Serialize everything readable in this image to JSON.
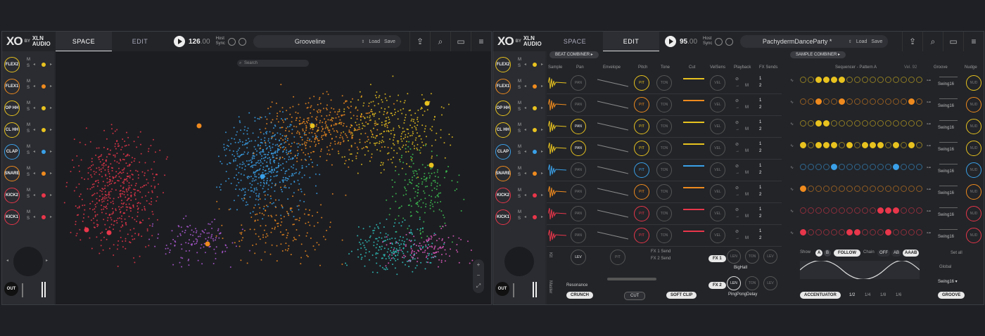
{
  "left": {
    "logo": {
      "mark": "XO",
      "by": "BY",
      "brand1": "XLN",
      "brand2": "AUDIO"
    },
    "tabs": [
      {
        "label": "SPACE",
        "active": true
      },
      {
        "label": "EDIT",
        "active": false
      }
    ],
    "bpm_int": "126",
    "bpm_dec": ".00",
    "host1": "Host",
    "host2": "Sync",
    "preset": "Grooveline",
    "load": "Load",
    "save": "Save",
    "search_placeholder": "Search",
    "out": "OUT",
    "zoom": [
      "+",
      "−",
      "⤢"
    ]
  },
  "right": {
    "logo": {
      "mark": "XO",
      "by": "BY",
      "brand1": "XLN",
      "brand2": "AUDIO"
    },
    "tabs": [
      {
        "label": "SPACE",
        "active": false
      },
      {
        "label": "EDIT",
        "active": true
      }
    ],
    "bpm_int": "95",
    "bpm_dec": ".00",
    "host1": "Host",
    "host2": "Sync",
    "preset": "PachydermDanceParty *",
    "load": "Load",
    "save": "Save",
    "beat_combiner": "BEAT COMBINER ▸",
    "sample_combiner": "SAMPLE COMBINER ▸",
    "columns": [
      "Sample",
      "Pan",
      "Envelope",
      "Pitch",
      "Tone",
      "Cut",
      "VelSens",
      "Playback",
      "FX Sends"
    ],
    "sequencer_title": "Sequencer - Pattern A",
    "vel": "Vel. 92",
    "groove": "Groove",
    "nudge": "Nudge",
    "knob_pan": "PAN",
    "knob_pit": "PIT",
    "knob_ton": "TON",
    "knob_vel": "VEL",
    "knob_nud": "NUD",
    "swing": "Swing16",
    "show": "Show",
    "show_a": "A",
    "show_b": "B",
    "follow": "FOLLOW",
    "chain": "Chain",
    "chain_opts": [
      "OFF",
      "AB",
      "AAAB"
    ],
    "set_all": "Set all",
    "global": "Global",
    "global_swing": "Swing16 ▾",
    "accentuator": "ACCENTUATOR",
    "rates": [
      "1/2",
      "1/4",
      "1/8",
      "1/6"
    ],
    "groove_btn": "GROOVE",
    "kit": "Kit",
    "master": "Master",
    "lev": "LEV",
    "pit": "PIT",
    "fx1_send": "FX 1 Send",
    "fx2_send": "FX 2 Send",
    "resonance": "Resonance",
    "crunch": "CRUNCH",
    "cut": "CUT",
    "soft_clip": "SOFT CLIP",
    "fx1": "FX 1",
    "fx2": "FX 2",
    "len": "LEN",
    "ton": "TON",
    "lev2": "LEV",
    "fx1_name": "BigHall",
    "fx2_name": "PingPongDelay",
    "out": "OUT",
    "fx_send_labels": [
      "1",
      "2"
    ],
    "m": "M"
  },
  "pads": [
    {
      "name": "FLEX2",
      "color": "#e8c21f"
    },
    {
      "name": "FLEX1",
      "color": "#ef8a1e"
    },
    {
      "name": "OP HH",
      "color": "#e8c21f"
    },
    {
      "name": "CL HH",
      "color": "#e8c21f"
    },
    {
      "name": "CLAP",
      "color": "#3aa0e8"
    },
    {
      "name": "SNARE",
      "color": "#ef8a1e"
    },
    {
      "name": "KICK2",
      "color": "#e8364a"
    },
    {
      "name": "KICK1",
      "color": "#e8364a"
    }
  ],
  "ms": {
    "m": "M",
    "s": "S"
  },
  "steps": [
    [
      0,
      0,
      1,
      1,
      1,
      1,
      0,
      0,
      0,
      0,
      0,
      0,
      0,
      0,
      0,
      0
    ],
    [
      0,
      0,
      1,
      0,
      0,
      1,
      0,
      0,
      0,
      0,
      0,
      0,
      0,
      0,
      1,
      0
    ],
    [
      0,
      0,
      1,
      1,
      0,
      0,
      0,
      0,
      0,
      0,
      0,
      0,
      0,
      0,
      0,
      0
    ],
    [
      1,
      0,
      1,
      1,
      1,
      0,
      1,
      0,
      1,
      1,
      1,
      0,
      1,
      0,
      1,
      0
    ],
    [
      0,
      0,
      0,
      0,
      1,
      0,
      0,
      0,
      0,
      0,
      0,
      0,
      1,
      0,
      0,
      0
    ],
    [
      1,
      0,
      0,
      0,
      0,
      0,
      0,
      0,
      0,
      0,
      0,
      0,
      0,
      0,
      0,
      0
    ],
    [
      0,
      0,
      0,
      0,
      0,
      0,
      0,
      0,
      0,
      0,
      1,
      1,
      1,
      0,
      0,
      0
    ],
    [
      1,
      0,
      0,
      0,
      0,
      0,
      1,
      1,
      0,
      0,
      0,
      1,
      0,
      0,
      0,
      0
    ]
  ],
  "colors": {
    "bg": "#1e2025",
    "panel": "#26282d",
    "red": "#e8364a",
    "orange": "#ef8a1e",
    "yellow": "#e8c21f",
    "blue": "#3aa0e8",
    "purple": "#b05ad8",
    "green": "#3ec452",
    "teal": "#2fc4c0"
  }
}
